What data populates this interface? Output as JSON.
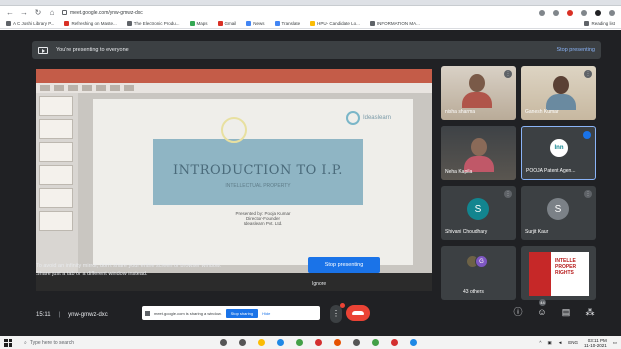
{
  "browser": {
    "url": "meet.google.com/ynw-gmwz-dxc",
    "bookmarks": [
      "A C Joshi Library P...",
      "Refreshing on Maste...",
      "The Electronic Produ...",
      "Maps",
      "Gmail",
      "News",
      "Translate",
      "HPU- Candidate Lo...",
      "INFORMATION MA..."
    ],
    "bookmarks_right": [
      "Reading list"
    ]
  },
  "meet": {
    "presenting_banner": "You're presenting to everyone",
    "stop_presenting_link": "Stop presenting",
    "mirror_warning_line1": "To avoid an infinity mirror, don't share your entire screen or browser window.",
    "mirror_warning_line2": "Share just a tab or a different window instead.",
    "stop_presenting_button": "Stop presenting",
    "ignore_label": "Ignore",
    "time": "15:11",
    "meeting_code": "ynw-gmwz-dxc",
    "share_banner_text": "meet.google.com is sharing a window.",
    "stop_sharing_label": "Stop sharing",
    "hide_label": "Hide",
    "people_count_badge": "44"
  },
  "slide": {
    "brand": "Ideaslearn",
    "title": "INTRODUCTION TO I.P.",
    "subtitle": "INTELLECTUAL PROPERTY",
    "presenter_line1": "Presented by: Pooja Kumar",
    "presenter_line2": "Director-Founder",
    "presenter_line3": "Ideaslearn Pvt. Ltd."
  },
  "participants": [
    {
      "name": "nisha sharma"
    },
    {
      "name": "Ganesh Kumar"
    },
    {
      "name": "Neha Kapila"
    },
    {
      "name": "POOJA Patent Agen..."
    },
    {
      "name": "Shivani Choudhary",
      "initial": "S"
    },
    {
      "name": "Surjit Kaur",
      "initial": "S"
    },
    {
      "name": "43 others",
      "initial": "G"
    },
    {
      "name": ""
    }
  ],
  "poster": {
    "line1": "INTELLE",
    "line2": "PROPER",
    "line3": "RIGHTS"
  },
  "taskbar": {
    "search_placeholder": "Type here to search",
    "language": "ENG",
    "clock_time": "03:11 PM",
    "clock_date": "11-10-2021"
  },
  "colors": {
    "meet_bg": "#202124",
    "accent": "#1a73e8",
    "end_call": "#ea4335"
  }
}
